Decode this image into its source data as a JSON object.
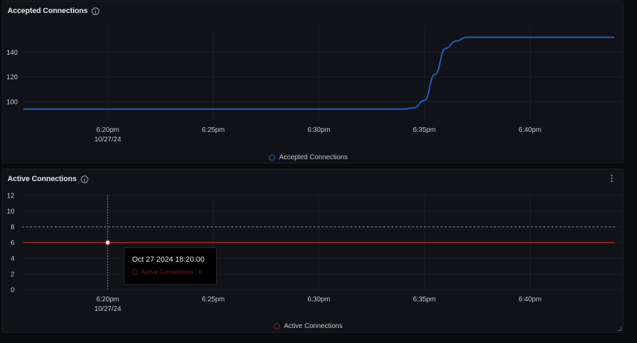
{
  "panels": [
    {
      "title": "Accepted Connections",
      "legend": "Accepted Connections",
      "color": "#1f60c4"
    },
    {
      "title": "Active Connections",
      "legend": "Active Connections",
      "color": "#8b1d1d"
    }
  ],
  "tooltip": {
    "time": "Oct 27 2024 18:20:00",
    "series_text": "Active Connections : 6"
  },
  "chart_data": [
    {
      "type": "line",
      "x_ticks": [
        "6:20pm",
        "6:25pm",
        "6:30pm",
        "6:35pm",
        "6:40pm"
      ],
      "x_tick_sublabel": "10/27/24",
      "y_ticks": [
        100,
        120,
        140
      ],
      "xlim": [
        "18:16",
        "18:44"
      ],
      "ylim": [
        85,
        160
      ],
      "series": [
        {
          "name": "Accepted Connections",
          "color": "#1f60c4",
          "points": [
            [
              "18:16",
              94
            ],
            [
              "18:34",
              94
            ],
            [
              "18:34.5",
              95
            ],
            [
              "18:35",
              101
            ],
            [
              "18:35.5",
              122
            ],
            [
              "18:36",
              143
            ],
            [
              "18:36.5",
              149
            ],
            [
              "18:37",
              152
            ],
            [
              "18:44",
              152
            ]
          ]
        }
      ]
    },
    {
      "type": "line",
      "x_ticks": [
        "6:20pm",
        "6:25pm",
        "6:30pm",
        "6:35pm",
        "6:40pm"
      ],
      "x_tick_sublabel": "10/27/24",
      "y_ticks": [
        0,
        2,
        4,
        6,
        8,
        10,
        12
      ],
      "threshold": 8,
      "xlim": [
        "18:16",
        "18:44"
      ],
      "ylim": [
        0,
        12
      ],
      "series": [
        {
          "name": "Active Connections",
          "color": "#8b1d1d",
          "points": [
            [
              "18:16",
              6
            ],
            [
              "18:44",
              6
            ]
          ]
        }
      ],
      "hover": {
        "x": "18:20",
        "y": 6
      }
    }
  ]
}
